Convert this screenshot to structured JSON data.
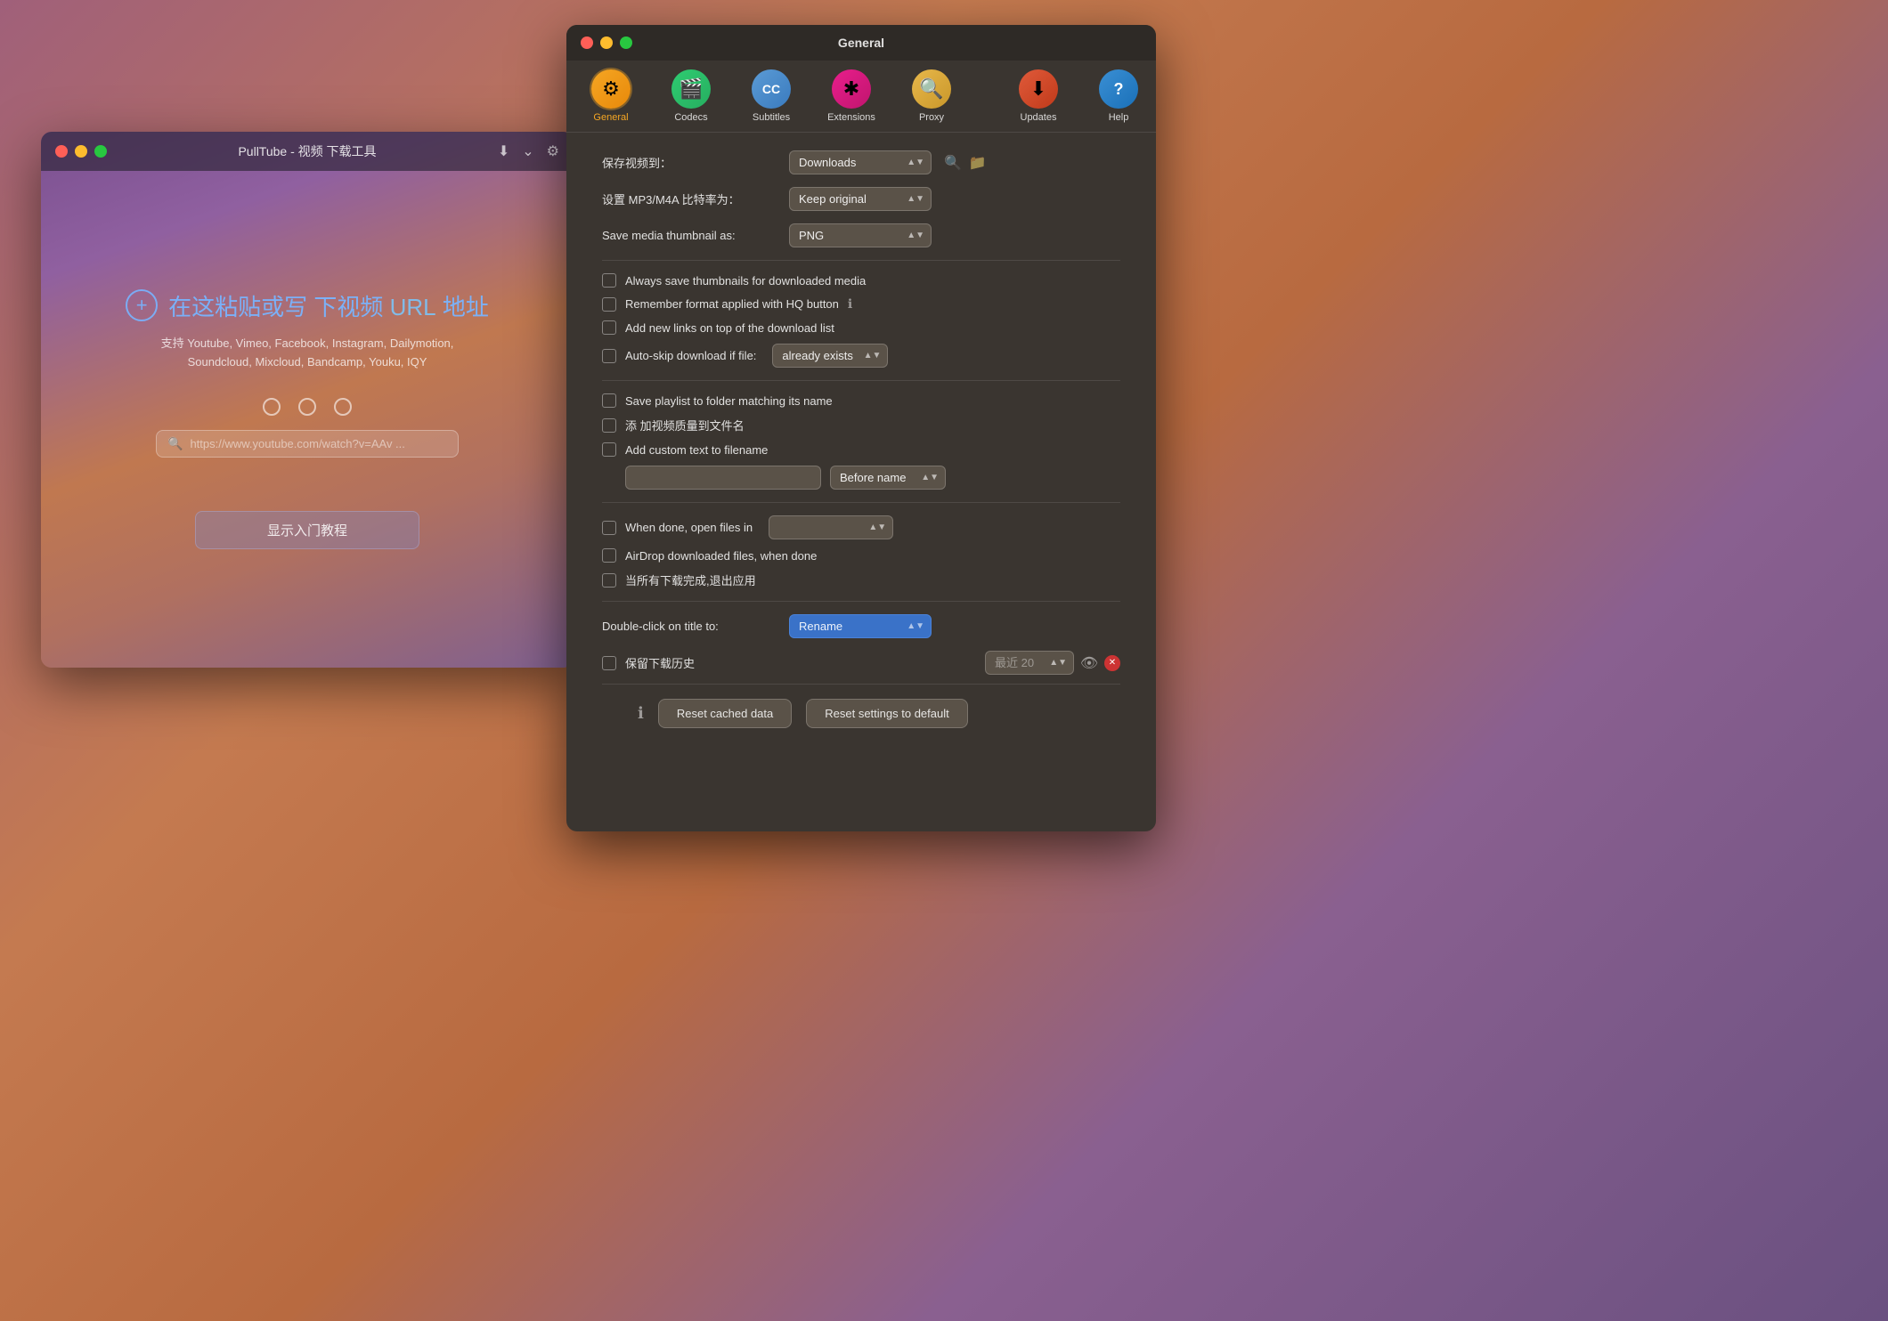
{
  "pulltube_window": {
    "title": "PullTube - 视频 下载工具",
    "url_paste_text": "在这粘贴或写 下视频 URL 地址",
    "url_part": "URL",
    "supported_sites": "支持 Youtube, Vimeo, Facebook, Instagram, Dailymotion,\nSoundcloud, Mixcloud, Bandcamp, Youku, IQY",
    "search_placeholder": "https://www.youtube.com/watch?v=AAv ...",
    "tutorial_btn": "显示入门教程"
  },
  "settings_window": {
    "title": "General",
    "toolbar": {
      "items": [
        {
          "id": "general",
          "label": "General",
          "icon": "⚙"
        },
        {
          "id": "codecs",
          "label": "Codecs",
          "icon": "🎬"
        },
        {
          "id": "subtitles",
          "label": "Subtitles",
          "icon": "CC"
        },
        {
          "id": "extensions",
          "label": "Extensions",
          "icon": "✱"
        },
        {
          "id": "proxy",
          "label": "Proxy",
          "icon": "🔍"
        },
        {
          "id": "updates",
          "label": "Updates",
          "icon": "⬇"
        },
        {
          "id": "help",
          "label": "Help",
          "icon": "?"
        }
      ]
    },
    "rows": {
      "save_to_label": "保存视频到：",
      "save_to_value": "Downloads",
      "bitrate_label": "设置 MP3/M4A 比特率为：",
      "bitrate_value": "Keep original",
      "thumbnail_label": "Save media thumbnail as:",
      "thumbnail_value": "PNG"
    },
    "checkboxes": {
      "always_save": "Always save thumbnails for downloaded media",
      "remember_format": "Remember format applied with HQ button",
      "add_new_links": "Add new links on top of the download list",
      "auto_skip": "Auto-skip download if file:",
      "auto_skip_value": "already exists",
      "save_playlist": "Save playlist to folder matching its name",
      "add_quality": "添 加视频质量到文件名",
      "add_custom": "Add custom text to filename",
      "when_done": "When done, open files in",
      "airdrop": "AirDrop downloaded files, when done",
      "quit_when_done": "当所有下载完成,退出应用",
      "keep_history": "保留下载历史"
    },
    "before_name_label": "Before name",
    "double_click_label": "Double-click on title to:",
    "double_click_value": "Rename",
    "history_value": "最近 20",
    "footer": {
      "info_icon": "ℹ",
      "reset_cached": "Reset cached data",
      "reset_settings": "Reset settings to default"
    }
  }
}
